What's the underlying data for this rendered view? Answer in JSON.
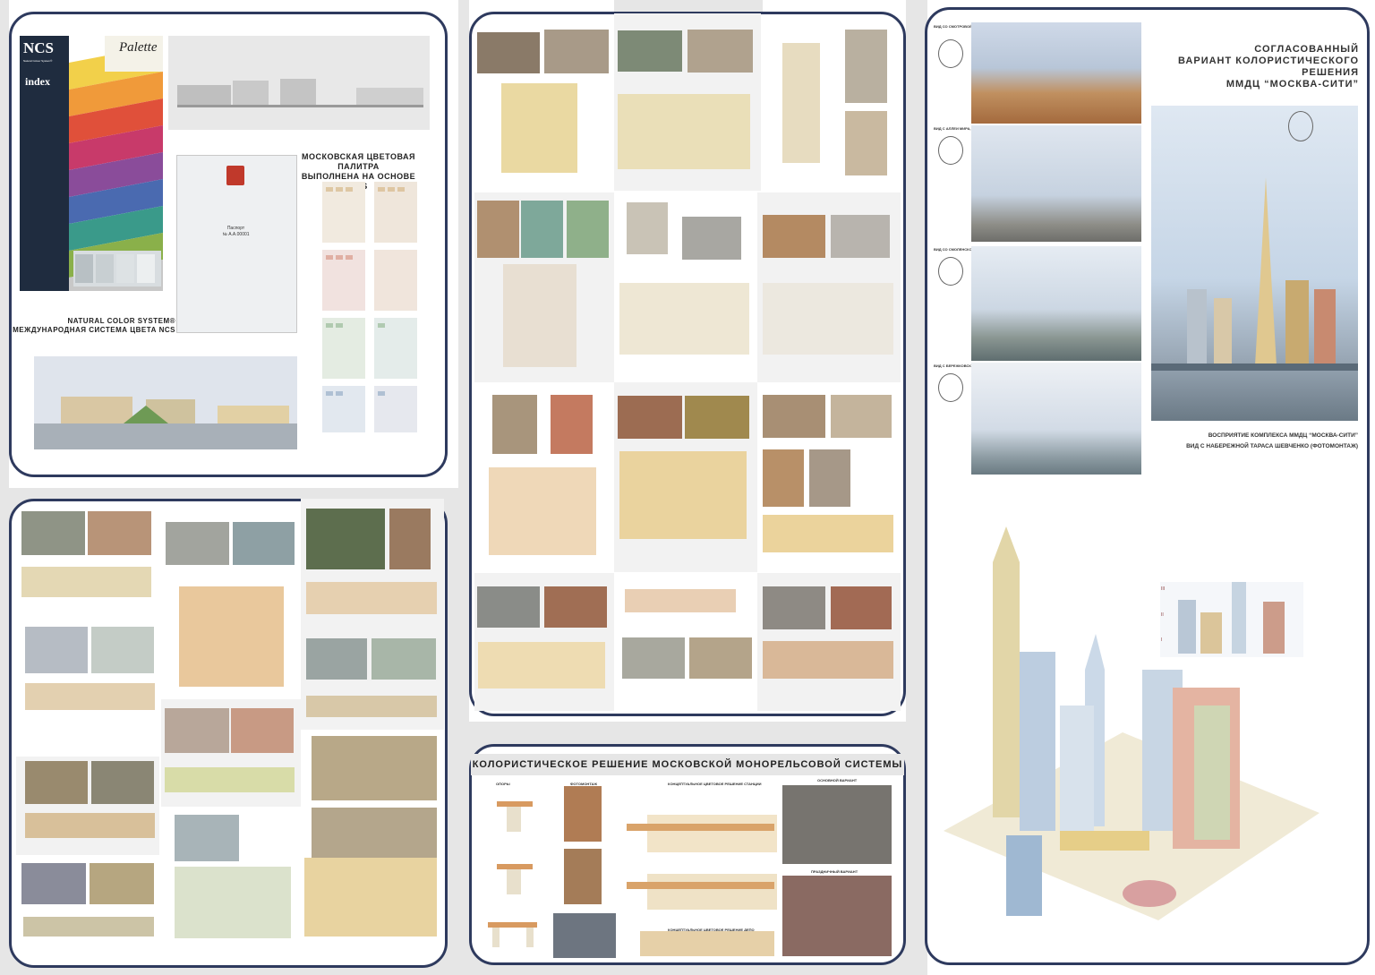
{
  "panel1": {
    "ncs_brand": "NCS",
    "ncs_sub": "Natural Colour System®",
    "ncs_palette": "Palette",
    "ncs_index": "index",
    "palette_title_line1": "МОСКОВСКАЯ ЦВЕТОВАЯ ПАЛИТРА",
    "palette_title_line2": "ВЫПОЛНЕНА НА ОСНОВЕ NCS",
    "ncs_caption_line1": "NATURAL COLOR SYSTEM®",
    "ncs_caption_line2": "МЕЖДУНАРОДНАЯ СИСТЕМА ЦВЕТА NCS",
    "passport_title": "Паспорт",
    "passport_number": "№ А.А.00001"
  },
  "monorail": {
    "title": "КОЛОРИСТИЧЕСКОЕ РЕШЕНИЕ МОСКОВСКОЙ МОНОРЕЛЬСОВОЙ СИСТЕМЫ",
    "col_supports": "ОПОРЫ",
    "col_photomontage": "ФОТОМОНТАЖ",
    "col_station": "КОНЦЕПТУАЛЬНОЕ ЦВЕТОВОЕ РЕШЕНИЕ СТАНЦИИ",
    "col_main": "ОСНОВНОЙ ВАРИАНТ",
    "col_festive": "ПРАЗДНИЧНЫЙ ВАРИАНТ",
    "col_depot": "КОНЦЕПТУАЛЬНОЕ ЦВЕТОВОЕ РЕШЕНИЕ ДЕПО"
  },
  "city": {
    "title_line1": "СОГЛАСОВАННЫЙ",
    "title_line2": "ВАРИАНТ КОЛОРИСТИЧЕСКОГО РЕШЕНИЯ",
    "title_line3": "ММДЦ “МОСКВА-СИТИ”",
    "view1": "ВИД СО СМОТРОВОЙ ПЛОЩАДКИ",
    "view2": "ВИД С АЛЛЕИ МИРА, ПОКЛОННАЯ ГОРА",
    "view3": "ВИД СО СМОЛЕНСКОЙ НАБЕРЕЖНОЙ",
    "view4": "ВИД С БЕРЕЖКОВСКОГО МОСТА, НОВОДЕВИЧЬЯ НАБЕРЕЖНАЯ",
    "caption_line1": "ВОСПРИЯТИЕ КОМПЛЕКСА ММДЦ “МОСКВА-СИТИ”",
    "caption_line2": "ВИД С НАБЕРЕЖНОЙ ТАРАСА ШЕВЧЕНКО (ФОТОМОНТАЖ)",
    "level3": "III",
    "level2": "II",
    "level1": "I"
  },
  "colors": {
    "frame": "#2e3a5e",
    "shade": "#e6e6e6",
    "sky": "#c8d8e8",
    "facade_yellow": "#e8d9a0"
  }
}
